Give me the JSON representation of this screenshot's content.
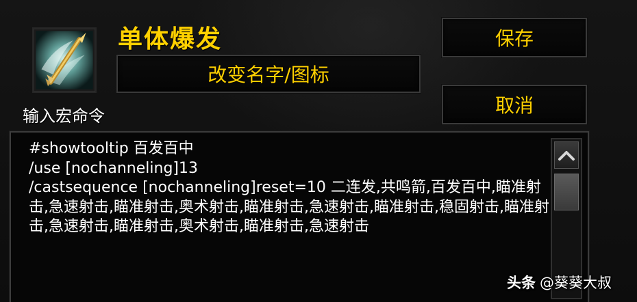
{
  "macro": {
    "name": "单体爆发",
    "icon": "arrow-shot-icon"
  },
  "buttons": {
    "change_name_icon": "改变名字/图标",
    "save": "保存",
    "cancel": "取消"
  },
  "editor": {
    "label": "输入宏命令",
    "text": "#showtooltip 百发百中\n/use [nochanneling]13\n/castsequence [nochanneling]reset=10 二连发,共鸣箭,百发百中,瞄准射击,急速射击,瞄准射击,奥术射击,瞄准射击,急速射击,瞄准射击,稳固射击,瞄准射击,急速射击,瞄准射击,奥术射击,瞄准射击,急速射击"
  },
  "scrollbar": {
    "up_icon": "chevron-up-icon"
  },
  "watermark": {
    "brand": "头条",
    "author": "@葵葵大叔"
  },
  "colors": {
    "gold": "#ffd100",
    "text": "#ffffff",
    "border": "#3a3a3a"
  }
}
